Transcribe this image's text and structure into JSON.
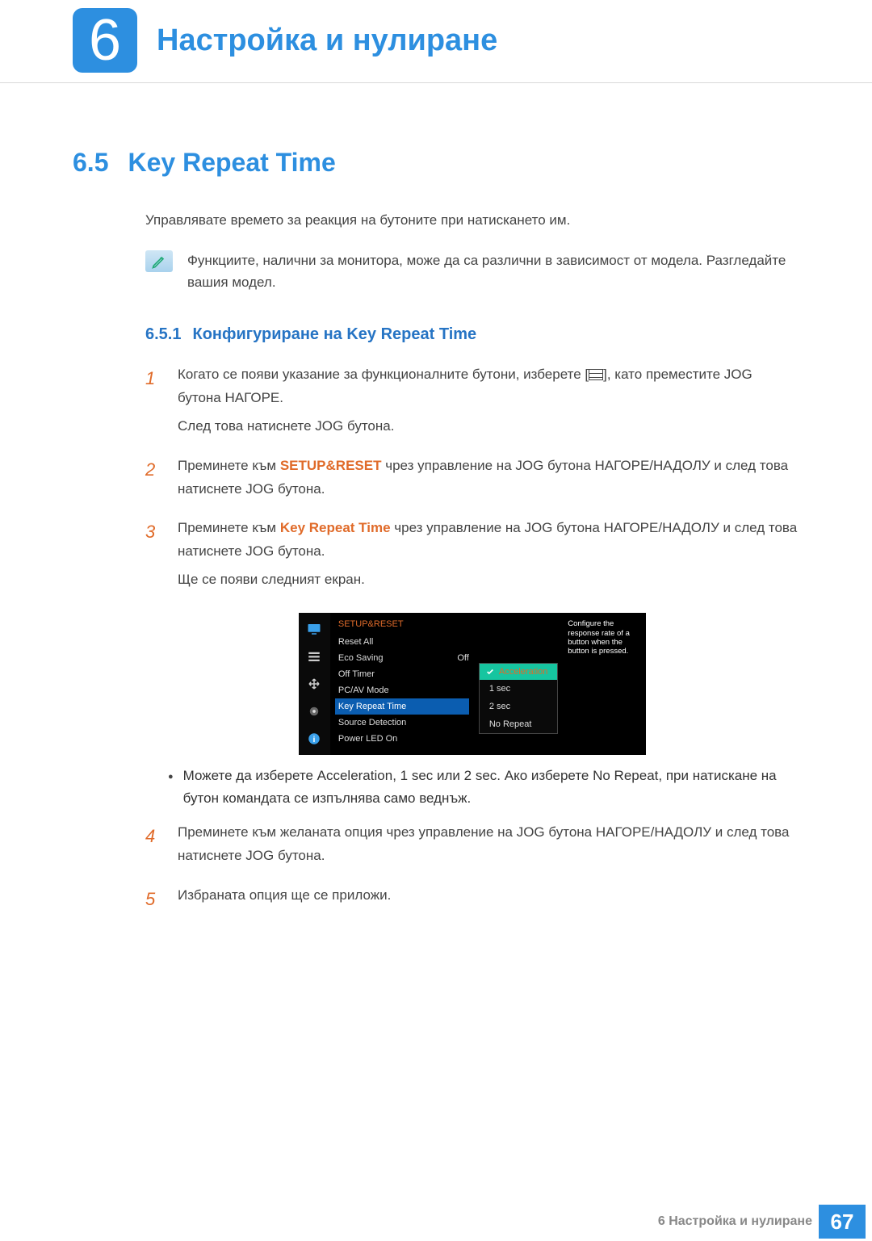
{
  "chapter": {
    "number": "6",
    "title": "Настройка и нулиране"
  },
  "section": {
    "number": "6.5",
    "title": "Key Repeat Time",
    "intro": "Управлявате времето за реакция на бутоните при натискането им.",
    "note": "Функциите, налични за монитора, може да са различни в зависимост от модела. Разгледайте вашия модел."
  },
  "subsection": {
    "number": "6.5.1",
    "title": "Конфигуриране на Key Repeat Time"
  },
  "steps": {
    "s1": {
      "num": "1",
      "p1a": "Когато се появи указание за функционалните бутони, изберете [",
      "p1b": "], като преместите JOG бутона НАГОРЕ.",
      "p2": "След това натиснете JOG бутона."
    },
    "s2": {
      "num": "2",
      "pre": "Преминете към ",
      "kw": "SETUP&RESET",
      "post": " чрез управление на JOG бутона НАГОРЕ/НАДОЛУ и след това натиснете JOG бутона."
    },
    "s3": {
      "num": "3",
      "pre": "Преминете към ",
      "kw": "Key Repeat Time",
      "post": " чрез управление на JOG бутона НАГОРЕ/НАДОЛУ и след това натиснете JOG бутона.",
      "p2": "Ще се появи следният екран."
    },
    "bullet": {
      "t1": "Можете да изберете ",
      "k1": "Acceleration",
      "c1": ", ",
      "k2": "1 sec",
      "c2": " или ",
      "k3": "2 sec",
      "c3": ". Ако изберете ",
      "k4": "No Repeat",
      "t2": ", при натискане на бутон командата се изпълнява само веднъж."
    },
    "s4": {
      "num": "4",
      "text": "Преминете към желаната опция чрез управление на JOG бутона НАГОРЕ/НАДОЛУ и след това натиснете JOG бутона."
    },
    "s5": {
      "num": "5",
      "text": "Избраната опция ще се приложи."
    }
  },
  "osd": {
    "title": "SETUP&RESET",
    "items": {
      "reset": "Reset All",
      "eco": "Eco Saving",
      "eco_val": "Off",
      "offtimer": "Off Timer",
      "pcav": "PC/AV Mode",
      "krt": "Key Repeat Time",
      "src": "Source Detection",
      "pled": "Power LED On"
    },
    "dropdown": {
      "head": "Acceleration",
      "opt1": "1 sec",
      "opt2": "2 sec",
      "opt3": "No Repeat"
    },
    "tip": "Configure the response rate of a button when the button is pressed."
  },
  "footer": {
    "label": "6 Настройка и нулиране",
    "page": "67"
  }
}
